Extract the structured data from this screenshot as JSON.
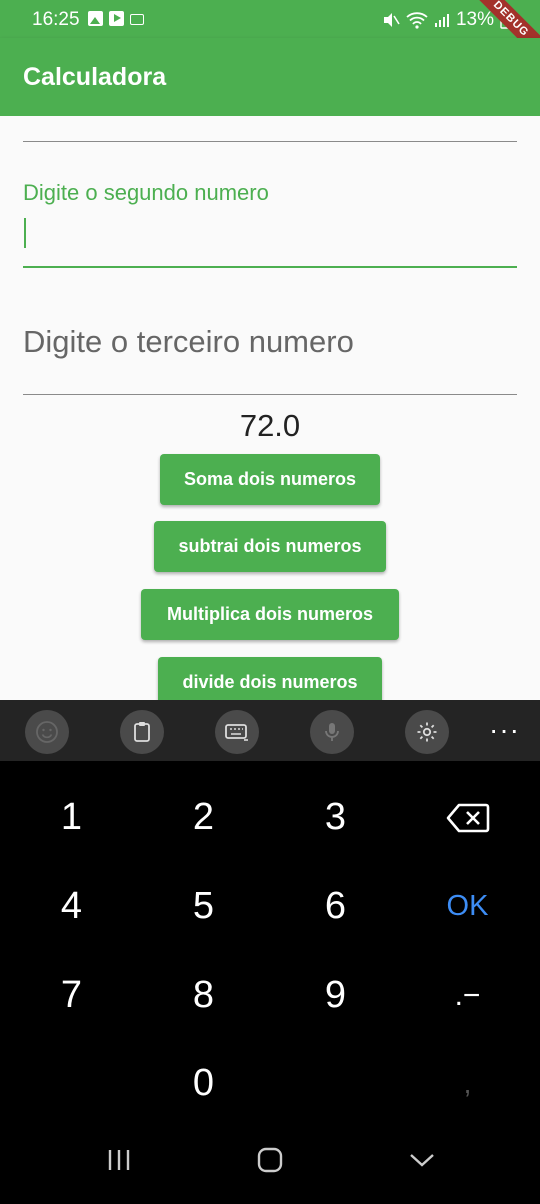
{
  "status_bar": {
    "time": "16:25",
    "battery": "13%",
    "debug": "DEBUG"
  },
  "app_bar": {
    "title": "Calculadora"
  },
  "fields": {
    "second_label": "Digite o segundo numero",
    "second_value": "",
    "third_placeholder": "Digite o terceiro numero"
  },
  "result": "72.0",
  "buttons": {
    "soma": "Soma dois numeros",
    "subtrai": "subtrai dois numeros",
    "multiplica": "Multiplica dois numeros",
    "divide": "divide dois numeros"
  },
  "keyboard": {
    "keys": [
      "1",
      "2",
      "3",
      "4",
      "5",
      "6",
      "7",
      "8",
      "9",
      "0"
    ],
    "ok": "OK",
    "decimal": ".−",
    "comma": ","
  },
  "colors": {
    "primary": "#4CAF50",
    "ok_key": "#3d8df5",
    "debug_ribbon": "#a3322b"
  }
}
